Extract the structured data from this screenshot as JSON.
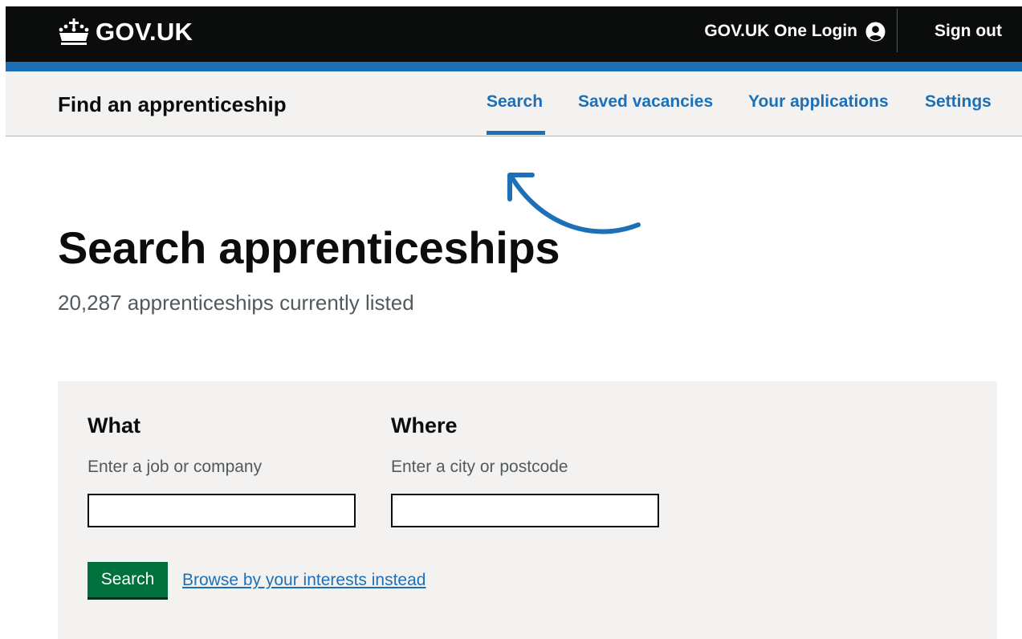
{
  "header": {
    "logo_text": "GOV.UK",
    "one_login": "GOV.UK One Login",
    "sign_out": "Sign out",
    "icons": {
      "logo": "crown-icon",
      "account": "user-icon"
    },
    "colors": {
      "background": "#0b0c0c",
      "accent_bar": "#1d70b8"
    }
  },
  "service_nav": {
    "service_name": "Find an apprenticeship",
    "items": [
      {
        "label": "Search",
        "active": true
      },
      {
        "label": "Saved vacancies",
        "active": false
      },
      {
        "label": "Your applications",
        "active": false
      },
      {
        "label": "Settings",
        "active": false
      }
    ]
  },
  "main": {
    "title": "Search apprenticeships",
    "count_text": "20,287 apprenticeships currently listed"
  },
  "search_form": {
    "what": {
      "label": "What",
      "hint": "Enter a job or company",
      "value": ""
    },
    "where": {
      "label": "Where",
      "hint": "Enter a city or postcode",
      "value": ""
    },
    "search_button": "Search",
    "browse_link": "Browse by your interests instead"
  },
  "annotation": {
    "icon": "curved-arrow-icon",
    "color": "#1d70b8"
  }
}
